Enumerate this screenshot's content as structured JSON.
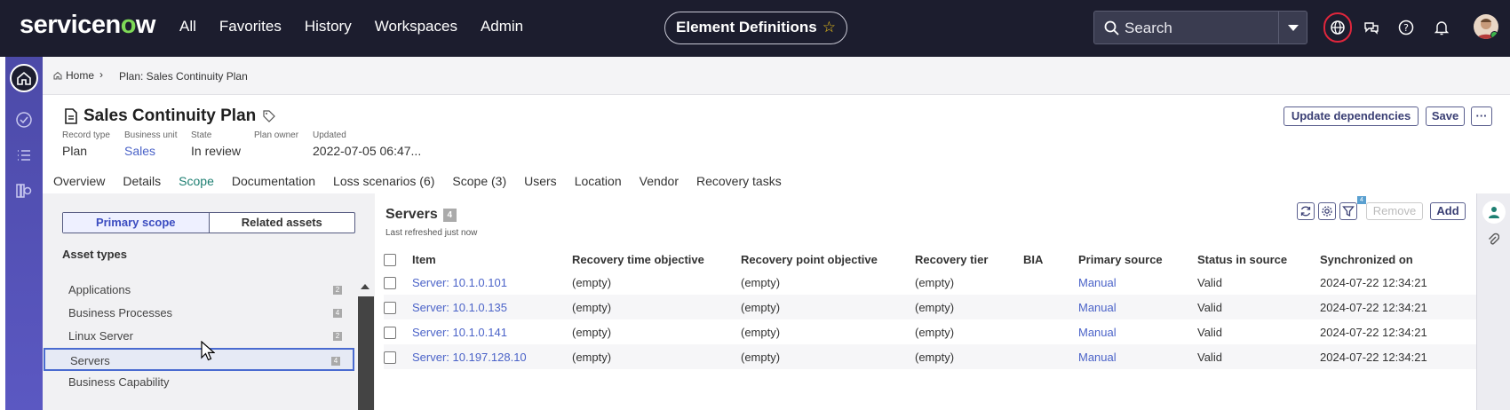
{
  "topbar": {
    "logo_text": "servicenow",
    "nav": [
      "All",
      "Favorites",
      "History",
      "Workspaces",
      "Admin"
    ],
    "element_definitions": "Element Definitions",
    "search_label": "Search"
  },
  "breadcrumb": {
    "home": "Home",
    "current": "Plan: Sales Continuity Plan"
  },
  "record": {
    "title": "Sales Continuity Plan",
    "fields": [
      {
        "label": "Record type",
        "value": "Plan"
      },
      {
        "label": "Business unit",
        "value": "Sales"
      },
      {
        "label": "State",
        "value": "In review"
      },
      {
        "label": "Plan owner",
        "value": ""
      },
      {
        "label": "Updated",
        "value": "2022-07-05 06:47..."
      }
    ],
    "buttons": {
      "update_dependencies": "Update dependencies",
      "save": "Save",
      "more": "···"
    }
  },
  "tabs": [
    "Overview",
    "Details",
    "Scope",
    "Documentation",
    "Loss scenarios (6)",
    "Scope (3)",
    "Users",
    "Location",
    "Vendor",
    "Recovery tasks"
  ],
  "active_tab": "Scope",
  "left_panel": {
    "toggle": [
      "Primary scope",
      "Related assets"
    ],
    "asset_types_heading": "Asset types",
    "items": [
      {
        "label": "Applications",
        "count": "2"
      },
      {
        "label": "Business Processes",
        "count": "4"
      },
      {
        "label": "Linux Server",
        "count": "2"
      },
      {
        "label": "Servers",
        "count": "4"
      },
      {
        "label": "Business Capability",
        "count": ""
      }
    ],
    "selected": "Servers"
  },
  "servers": {
    "title": "Servers",
    "count": "4",
    "refreshed": "Last refreshed just now",
    "filter_count": "4",
    "remove_label": "Remove",
    "add_label": "Add",
    "columns": [
      "Item",
      "Recovery time objective",
      "Recovery point objective",
      "Recovery tier",
      "BIA",
      "Primary source",
      "Status in source",
      "Synchronized on"
    ],
    "rows": [
      {
        "item": "Server: 10.1.0.101",
        "rto": "(empty)",
        "rpo": "(empty)",
        "tier": "(empty)",
        "bia": "",
        "source": "Manual",
        "status": "Valid",
        "sync": "2024-07-22 12:34:21"
      },
      {
        "item": "Server: 10.1.0.135",
        "rto": "(empty)",
        "rpo": "(empty)",
        "tier": "(empty)",
        "bia": "",
        "source": "Manual",
        "status": "Valid",
        "sync": "2024-07-22 12:34:21"
      },
      {
        "item": "Server: 10.1.0.141",
        "rto": "(empty)",
        "rpo": "(empty)",
        "tier": "(empty)",
        "bia": "",
        "source": "Manual",
        "status": "Valid",
        "sync": "2024-07-22 12:34:21"
      },
      {
        "item": "Server: 10.197.128.10",
        "rto": "(empty)",
        "rpo": "(empty)",
        "tier": "(empty)",
        "bia": "",
        "source": "Manual",
        "status": "Valid",
        "sync": "2024-07-22 12:34:21"
      }
    ]
  },
  "colors": {
    "topbar": "#1c1d2e",
    "accent_green": "#7ed957",
    "link": "#4b63c8",
    "tab_active": "#1e7f72",
    "rail": "#4c4aa8"
  }
}
